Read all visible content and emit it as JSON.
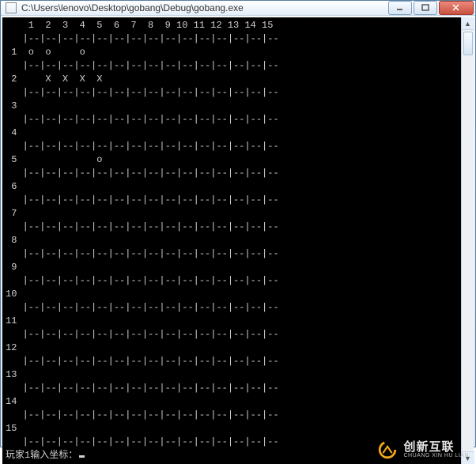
{
  "window": {
    "title": "C:\\Users\\lenovo\\Desktop\\gobang\\Debug\\gobang.exe"
  },
  "board": {
    "size": 15,
    "header": [
      "1",
      "2",
      "3",
      "4",
      "5",
      "6",
      "7",
      "8",
      "9",
      "10",
      "11",
      "12",
      "13",
      "14",
      "15"
    ],
    "rows": [
      "1",
      "2",
      "3",
      "4",
      "5",
      "6",
      "7",
      "8",
      "9",
      "10",
      "11",
      "12",
      "13",
      "14",
      "15"
    ],
    "cells": {
      "1": {
        "1": "o",
        "2": "o",
        "4": "o"
      },
      "2": {
        "2": "X",
        "3": "X",
        "4": "X",
        "5": "X"
      },
      "5": {
        "5": "o"
      }
    },
    "prompt": "玩家1输入坐标："
  },
  "watermark": {
    "cn": "创新互联",
    "en": "CHUANG XIN HU LIAN"
  }
}
